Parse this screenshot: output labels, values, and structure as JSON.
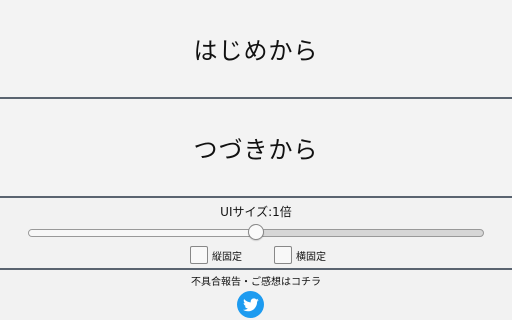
{
  "menu": {
    "start_label": "はじめから",
    "continue_label": "つづきから"
  },
  "settings": {
    "ui_size_label": "UIサイズ:1倍",
    "ui_size_slider_fraction": 0.5,
    "vertical_lock_label": "縦固定",
    "vertical_lock_checked": false,
    "horizontal_lock_label": "横固定",
    "horizontal_lock_checked": false
  },
  "footer": {
    "feedback_text": "不具合報告・ご感想はコチラ",
    "twitter_icon": "twitter-bird-icon"
  },
  "colors": {
    "divider": "#5a6470",
    "twitter_blue": "#1d9bf0",
    "background": "#f2f2f2"
  }
}
